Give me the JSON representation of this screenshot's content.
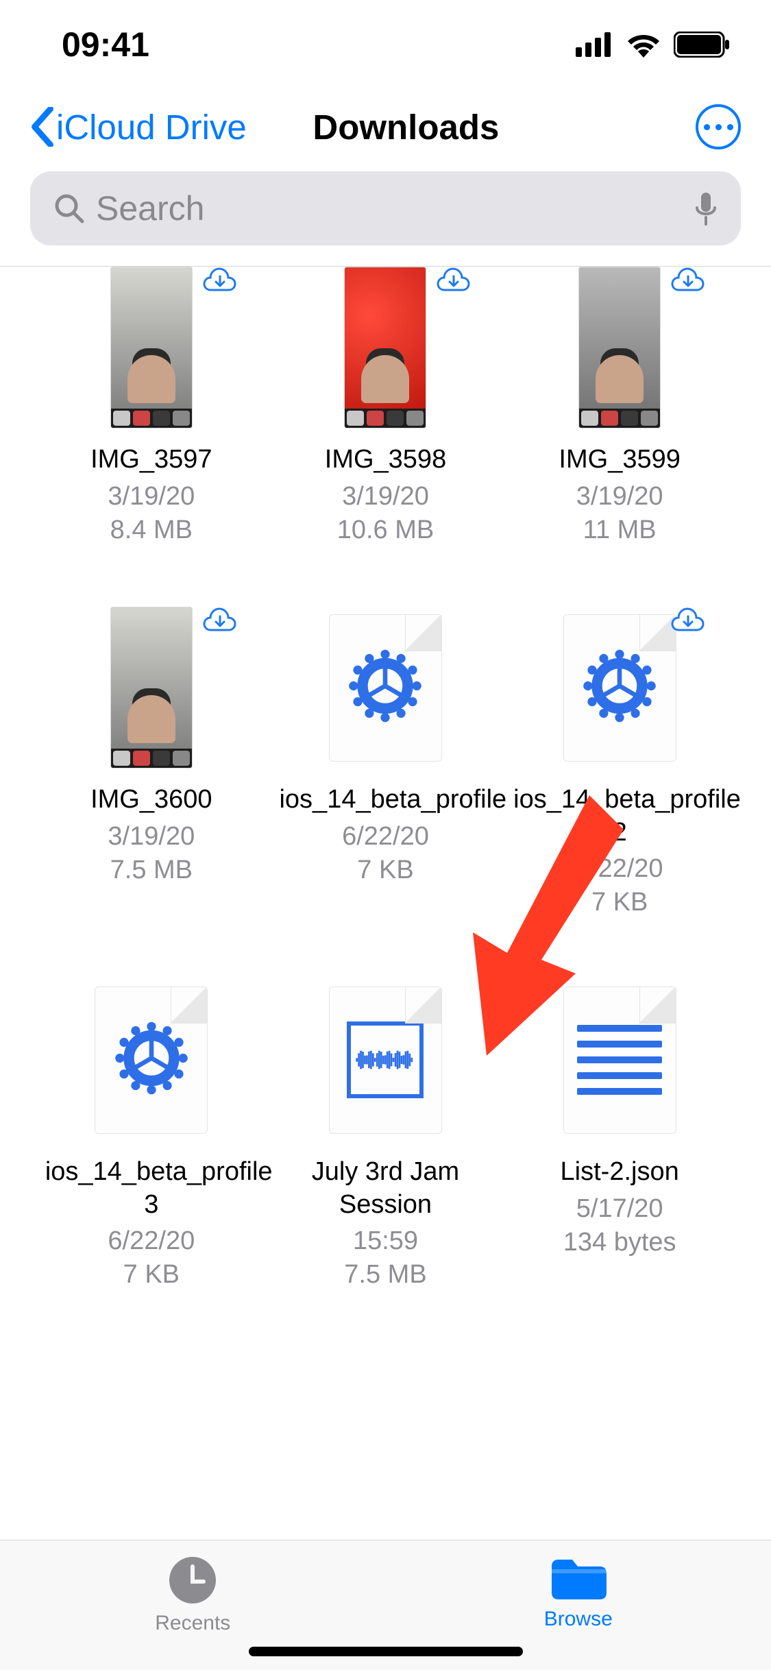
{
  "status": {
    "time": "09:41"
  },
  "nav": {
    "back_label": "iCloud Drive",
    "title": "Downloads"
  },
  "search": {
    "placeholder": "Search"
  },
  "files": [
    {
      "name": "IMG_3597",
      "date": "3/19/20",
      "size": "8.4 MB",
      "kind": "photo",
      "variant": "room-bg",
      "cloud": true
    },
    {
      "name": "IMG_3598",
      "date": "3/19/20",
      "size": "10.6 MB",
      "kind": "photo",
      "variant": "red-bg",
      "cloud": true
    },
    {
      "name": "IMG_3599",
      "date": "3/19/20",
      "size": "11 MB",
      "kind": "photo",
      "variant": "city-bg",
      "cloud": true
    },
    {
      "name": "IMG_3600",
      "date": "3/19/20",
      "size": "7.5 MB",
      "kind": "photo",
      "variant": "room-bg",
      "cloud": true
    },
    {
      "name": "ios_14_beta_profile",
      "date": "6/22/20",
      "size": "7 KB",
      "kind": "gear",
      "cloud": false
    },
    {
      "name": "ios_14_beta_profile 2",
      "date": "6/22/20",
      "size": "7 KB",
      "kind": "gear",
      "cloud": true
    },
    {
      "name": "ios_14_beta_profile 3",
      "date": "6/22/20",
      "size": "7 KB",
      "kind": "gear",
      "cloud": false
    },
    {
      "name": "July 3rd Jam Session",
      "date": "15:59",
      "size": "7.5 MB",
      "kind": "audio",
      "cloud": false
    },
    {
      "name": "List-2.json",
      "date": "5/17/20",
      "size": "134 bytes",
      "kind": "text",
      "cloud": false
    }
  ],
  "tabs": {
    "recents_label": "Recents",
    "browse_label": "Browse"
  }
}
